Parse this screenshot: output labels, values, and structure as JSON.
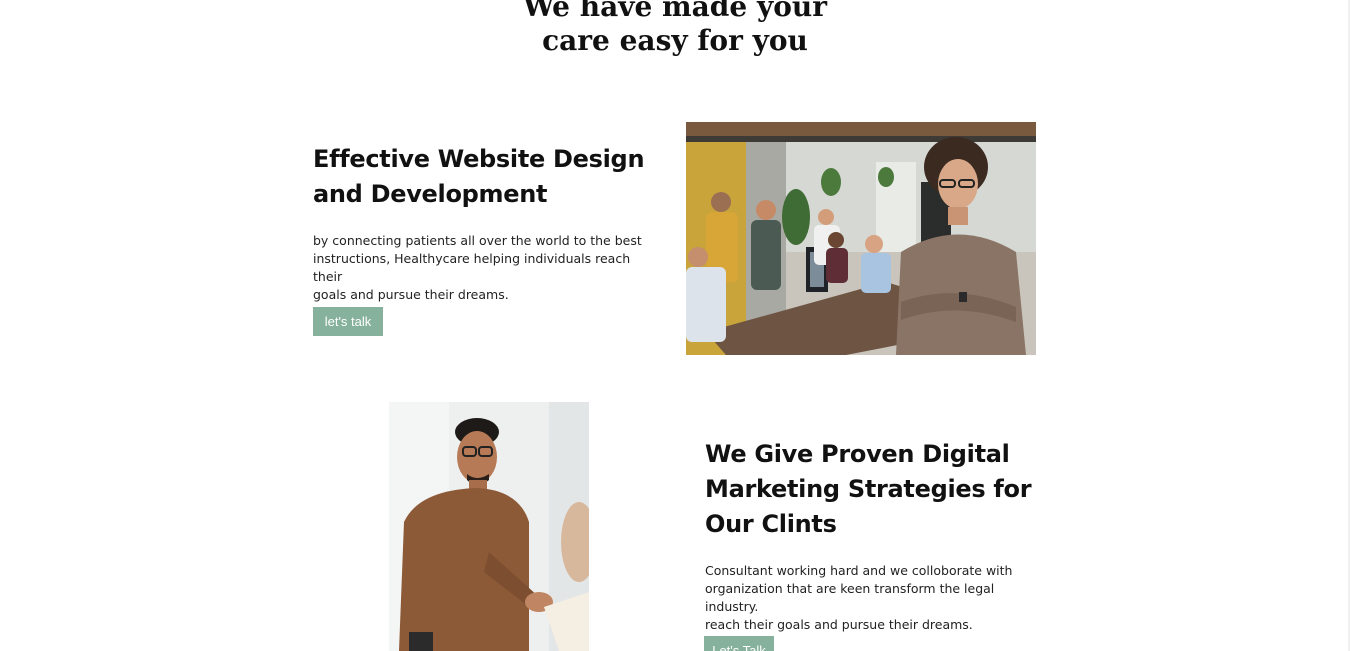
{
  "hero": {
    "heading_line1": "We have made your",
    "heading_line2": "care easy for you"
  },
  "section1": {
    "title_line1": "Effective Website Design",
    "title_line2": "and Development",
    "text_line1": "by connecting patients all over the world to the best",
    "text_line2": "instructions, Healthycare helping individuals reach their",
    "text_line3": "goals and pursue their dreams.",
    "button_label": "let's talk"
  },
  "section2": {
    "title_line1": "We Give Proven Digital",
    "title_line2": "Marketing Strategies for",
    "title_line3": "Our Clints",
    "text_line1": "Consultant working hard and we colloborate with",
    "text_line2": "organization that are keen transform the legal industry.",
    "text_line3": "reach their goals and pursue their dreams.",
    "button_label": "Let's Talk"
  },
  "colors": {
    "accent": "#86b19c",
    "text": "#111111",
    "background": "#ffffff"
  }
}
